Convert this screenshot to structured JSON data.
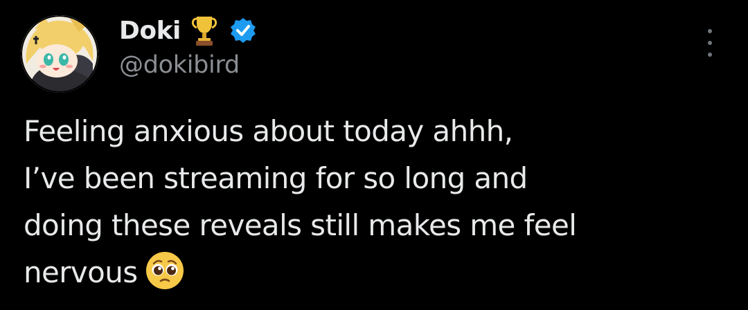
{
  "author": {
    "display_name": "Doki",
    "handle": "@dokibird",
    "badge_icon": "trophy-icon",
    "verified_icon": "verified-badge-icon",
    "verified_color": "#1d9bf0",
    "avatar_icon": "avatar-image"
  },
  "tweet": {
    "lines": [
      "Feeling anxious about today ahhh,",
      "I’ve been streaming for so long and",
      "doing these reveals still makes me feel",
      "nervous"
    ],
    "emoji": "pleading-face-emoji"
  },
  "menu": {
    "icon": "more-options-icon"
  },
  "colors": {
    "background": "#000000",
    "primary_text": "#e7e9ea",
    "secondary_text": "#8b8f94"
  }
}
